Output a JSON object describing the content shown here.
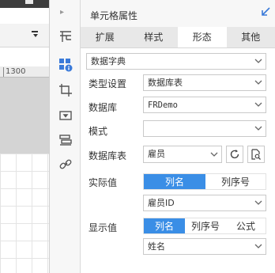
{
  "ruler": {
    "value": "1300"
  },
  "panel": {
    "title": "单元格属性",
    "tabs": [
      "扩展",
      "样式",
      "形态",
      "其他"
    ],
    "active_tab": 2,
    "form_type": {
      "value": "数据字典"
    },
    "type_setting": {
      "label": "类型设置",
      "value": "数据库表"
    },
    "database": {
      "label": "数据库",
      "value": "FRDemo"
    },
    "schema": {
      "label": "模式",
      "value": ""
    },
    "db_table": {
      "label": "数据库表",
      "value": "雇员"
    },
    "actual_value": {
      "label": "实际值",
      "options": [
        "列名",
        "列序号"
      ],
      "selected": 0,
      "field": "雇员ID"
    },
    "display_value": {
      "label": "显示值",
      "options": [
        "列名",
        "列序号",
        "公式"
      ],
      "selected": 0,
      "field": "姓名"
    }
  },
  "colors": {
    "accent": "#3a8ee6",
    "icon_blue": "#3a7ad9"
  },
  "icons": [
    "cell-expand-icon",
    "cell-attr-icon",
    "crop-icon",
    "widget-icon",
    "condition-icon",
    "link-icon"
  ]
}
